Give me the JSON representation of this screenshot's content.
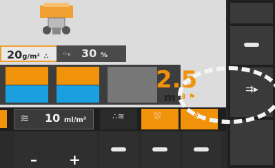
{
  "status": {
    "rate_value": "20",
    "rate_unit": "g/m²",
    "humidity_value": "30",
    "humidity_unit": "%"
  },
  "level": {
    "width_value": "2.5",
    "width_unit": "m",
    "boom_label": "3"
  },
  "spray": {
    "value": "10",
    "unit": "ml/m²"
  },
  "softkeys": {
    "minus": "–",
    "plus": "+"
  },
  "colors": {
    "accent": "#f0920a",
    "water": "#1aa0e0",
    "panel": "#dcdcdc"
  }
}
